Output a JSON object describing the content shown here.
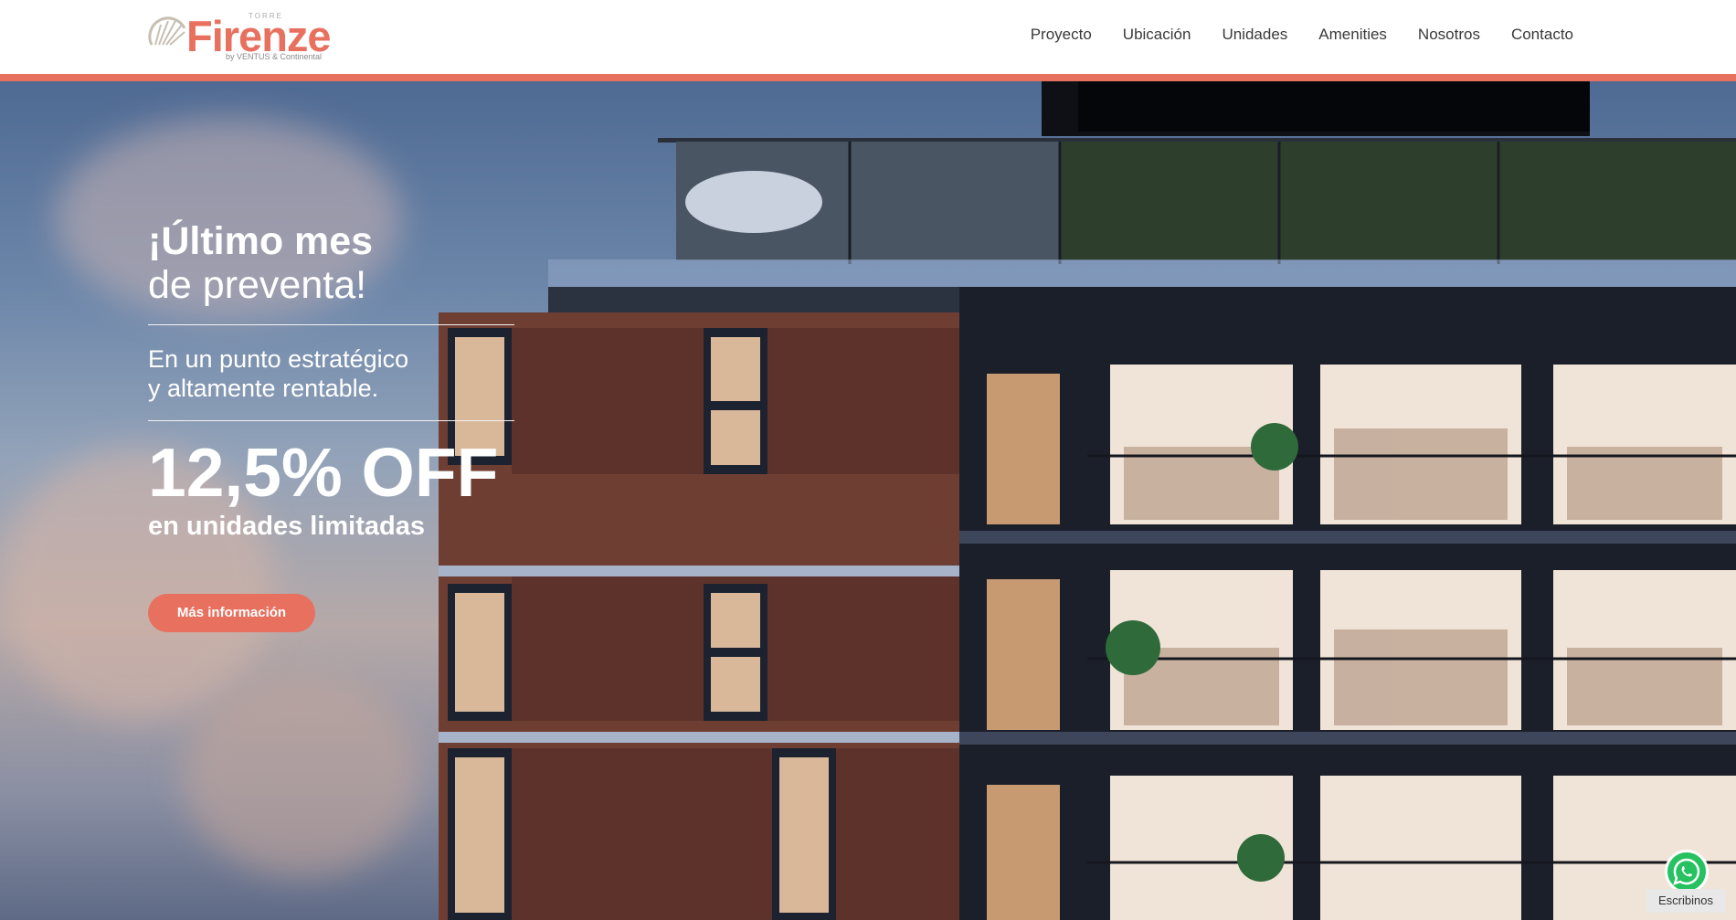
{
  "brand": {
    "name": "Firenze",
    "prefix": "TORRE",
    "byline": "by VENTUS & Continental"
  },
  "nav": {
    "items": [
      "Proyecto",
      "Ubicación",
      "Unidades",
      "Amenities",
      "Nosotros",
      "Contacto"
    ]
  },
  "hero": {
    "headline_bold": "¡Último mes",
    "headline_regular": "de preventa!",
    "sub_line1": "En un punto estratégico",
    "sub_line2": "y altamente rentable.",
    "offer": "12,5% OFF",
    "offer_sub": "en unidades limitadas",
    "cta_label": "Más información"
  },
  "whatsapp": {
    "label": "Escribinos",
    "icon": "whatsapp-icon"
  },
  "colors": {
    "accent": "#e8705e",
    "whatsapp": "#26c160"
  }
}
